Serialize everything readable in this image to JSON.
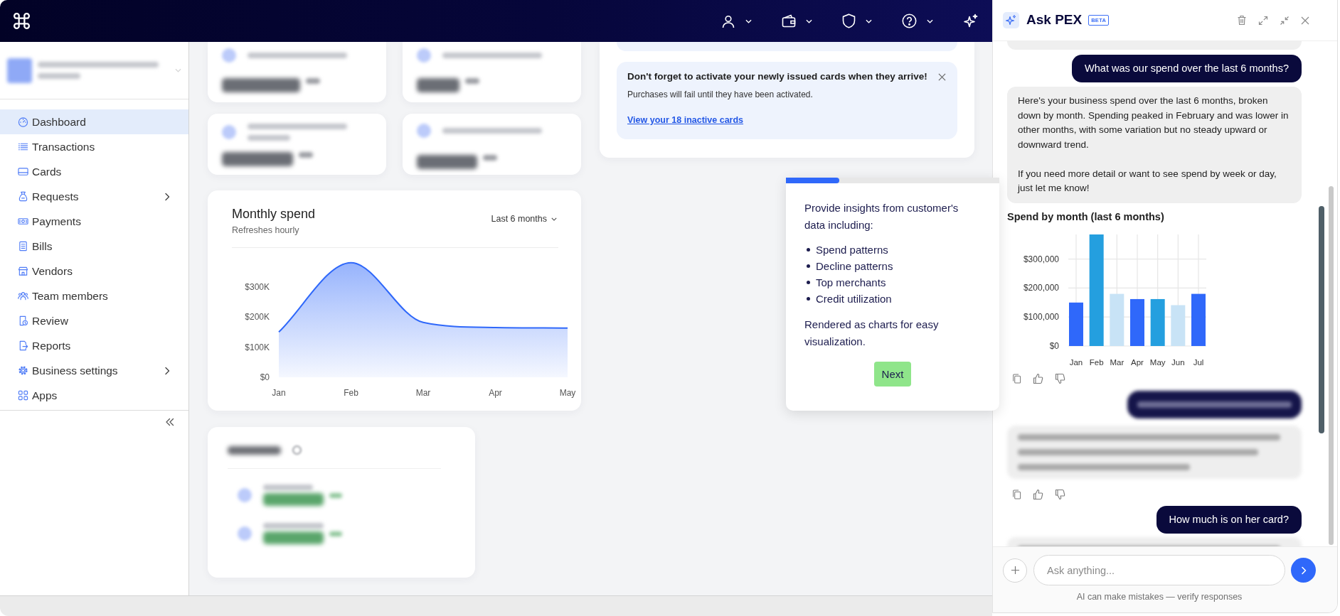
{
  "sidebar": {
    "items": [
      {
        "label": "Dashboard",
        "selected": true,
        "expandable": false
      },
      {
        "label": "Transactions",
        "selected": false,
        "expandable": false
      },
      {
        "label": "Cards",
        "selected": false,
        "expandable": false
      },
      {
        "label": "Requests",
        "selected": false,
        "expandable": true
      },
      {
        "label": "Payments",
        "selected": false,
        "expandable": false
      },
      {
        "label": "Bills",
        "selected": false,
        "expandable": false
      },
      {
        "label": "Vendors",
        "selected": false,
        "expandable": false
      },
      {
        "label": "Team members",
        "selected": false,
        "expandable": false
      },
      {
        "label": "Review",
        "selected": false,
        "expandable": false
      },
      {
        "label": "Reports",
        "selected": false,
        "expandable": false
      },
      {
        "label": "Business settings",
        "selected": false,
        "expandable": true
      },
      {
        "label": "Apps",
        "selected": false,
        "expandable": false
      }
    ]
  },
  "notice": {
    "title": "Don't forget to activate your newly issued cards when they arrive!",
    "text": "Purchases will fail until they have been activated.",
    "link": "View your 18 inactive cards"
  },
  "monthly_spend": {
    "title": "Monthly spend",
    "subtitle": "Refreshes hourly",
    "range": "Last 6 months",
    "chart_data": {
      "type": "area",
      "categories": [
        "Jan",
        "Feb",
        "Mar",
        "Apr",
        "May"
      ],
      "series": [
        {
          "color": "#2f68fa",
          "values": [
            150000,
            380000,
            182000,
            165000,
            163000
          ]
        }
      ],
      "ylim": [
        0,
        430000
      ],
      "yticks": [
        {
          "value": 0,
          "label": "$0"
        },
        {
          "value": 100000,
          "label": "$100K"
        },
        {
          "value": 200000,
          "label": "$200K"
        },
        {
          "value": 300000,
          "label": "$300K"
        }
      ]
    }
  },
  "tour": {
    "level": 0.25,
    "intro": "Provide insights from customer's data including:",
    "bullets": [
      "Spend patterns",
      "Decline patterns",
      "Top merchants",
      "Credit utilization"
    ],
    "outro": "Rendered as charts for easy visualization.",
    "button": "Next"
  },
  "assistant": {
    "title": "Ask PEX",
    "badge": "BETA",
    "messages": [
      {
        "kind": "assistant",
        "blurred": false,
        "actions": false
      },
      {
        "kind": "user",
        "blurred": false,
        "text": "What was our spend over the last 6 months?"
      },
      {
        "kind": "assistant",
        "blurred": false,
        "actions": true,
        "paragraphs": [
          "Here's your business spend over the last 6 months, broken down by month. Spending peaked in February and was lower in other months, with some variation but no steady upward or downward trend.",
          "If you need more detail or want to see spend by week or day, just let me know!"
        ],
        "chart": {
          "title": "Spend by month (last 6 months)",
          "chart_data": {
            "type": "bar",
            "categories": [
              "Jan",
              "Feb",
              "Mar",
              "Apr",
              "May",
              "Jun",
              "Jul"
            ],
            "series": [
              {
                "color": "#2f68fa",
                "values": [
                  150000,
                  null,
                  null,
                  162000,
                  null,
                  null,
                  180000
                ]
              },
              {
                "color": "#249fdf",
                "values": [
                  null,
                  385000,
                  null,
                  null,
                  162000,
                  null,
                  null
                ]
              },
              {
                "color": "#c8e3f6",
                "values": [
                  null,
                  null,
                  180000,
                  null,
                  null,
                  141000,
                  null
                ]
              }
            ],
            "stacked": true,
            "grid": true,
            "ylim": [
              0,
              385000
            ],
            "yticks": [
              {
                "value": 0,
                "label": "$0"
              },
              {
                "value": 100000,
                "label": "$100,000"
              },
              {
                "value": 200000,
                "label": "$200,000"
              },
              {
                "value": 300000,
                "label": "$300,000"
              }
            ]
          }
        }
      },
      {
        "kind": "user",
        "blurred": true
      },
      {
        "kind": "assistant",
        "blurred": true,
        "actions": true
      },
      {
        "kind": "user",
        "blurred": false,
        "text": "How much is on her card?"
      },
      {
        "kind": "assistant",
        "blurred": true,
        "actions": false
      }
    ],
    "composer": {
      "placeholder": "Ask anything...",
      "disclaimer": "AI can make mistakes — verify responses"
    }
  }
}
